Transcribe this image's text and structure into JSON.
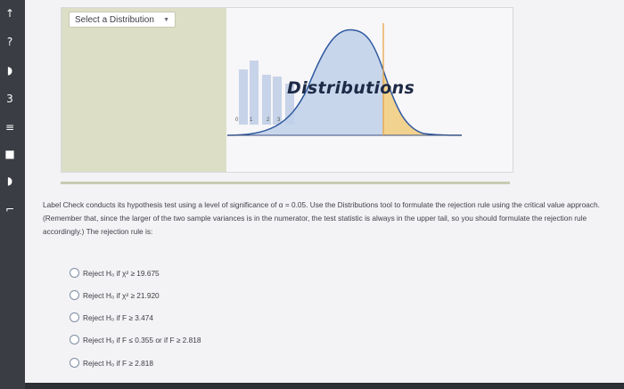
{
  "tool": {
    "select_label": "Select a Distribution",
    "logo_title": "Distributions",
    "logo_ticks": [
      "0",
      "1",
      "2",
      "3"
    ]
  },
  "question": {
    "text": "Label Check conducts its hypothesis test using a level of significance of α = 0.05. Use the Distributions tool to formulate the rejection rule using the critical value approach. (Remember that, since the larger of the two sample variances is in the numerator, the test statistic is always in the upper tail, so you should formulate the rejection rule accordingly.) The rejection rule is:"
  },
  "options": [
    "Reject H₀ if χ² ≥ 19.675",
    "Reject H₀ if χ² ≥ 21.920",
    "Reject H₀ if F ≥ 3.474",
    "Reject H₀ if F ≤ 0.355 or if F ≥ 2.818",
    "Reject H₀ if F ≥ 2.818"
  ],
  "colors": {
    "curve_fill": "#bfd0ea",
    "curve_line": "#2f5aa0",
    "tail_fill": "#f2d28f",
    "critical_line": "#e7a03c",
    "bars": "#c7d3e8"
  }
}
